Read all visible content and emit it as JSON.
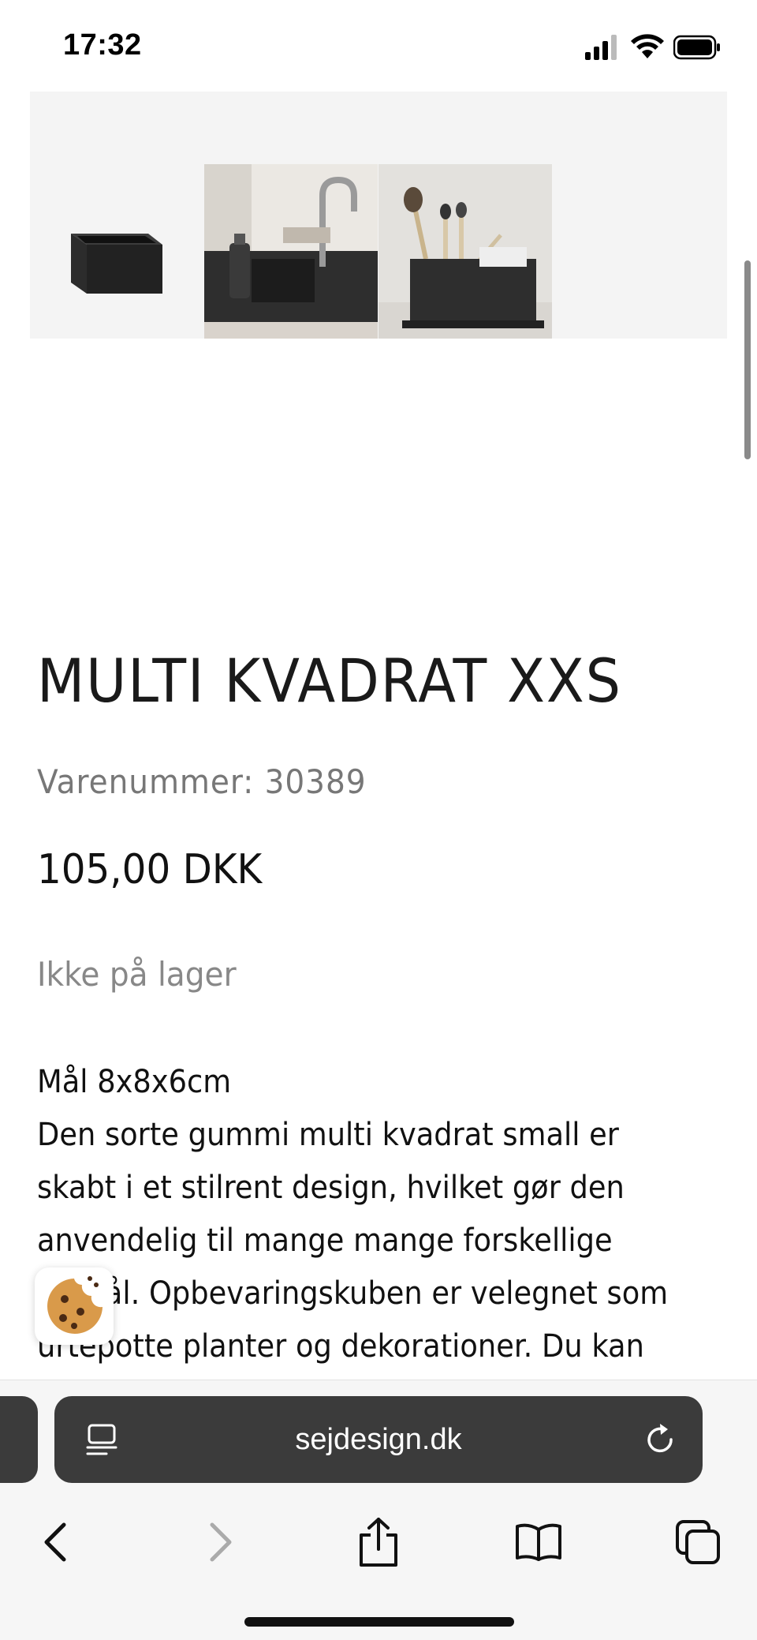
{
  "status_bar": {
    "time": "17:32",
    "icons": [
      "signal-icon",
      "wifi-icon",
      "battery-icon"
    ]
  },
  "gallery": {
    "thumbnails": [
      {
        "name": "black rubber cube"
      },
      {
        "name": "kitchen sink with organizer"
      },
      {
        "name": "makeup brushes in organizer"
      }
    ]
  },
  "product": {
    "title": "MULTI KVADRAT XXS",
    "sku": "Varenummer: 30389",
    "price": "105,00 DKK",
    "stock_status": "Ikke på lager",
    "description_lines": [
      "Mål 8x8x6cm",
      "Den sorte gummi multi kvadrat small er",
      "skabt i et stilrent design, hvilket gør den",
      "anvendelig til mange mange forskellige",
      "formål. Opbevaringskuben er velegnet som",
      "urtepotte planter og dekorationer. Du kan"
    ]
  },
  "browser": {
    "url": "sejdesign.dk",
    "toolbar": [
      "back-icon",
      "forward-icon",
      "share-icon",
      "bookmarks-icon",
      "tabs-icon"
    ]
  },
  "colors": {
    "accent": "#3b3b3b",
    "muted_text": "#808080"
  }
}
